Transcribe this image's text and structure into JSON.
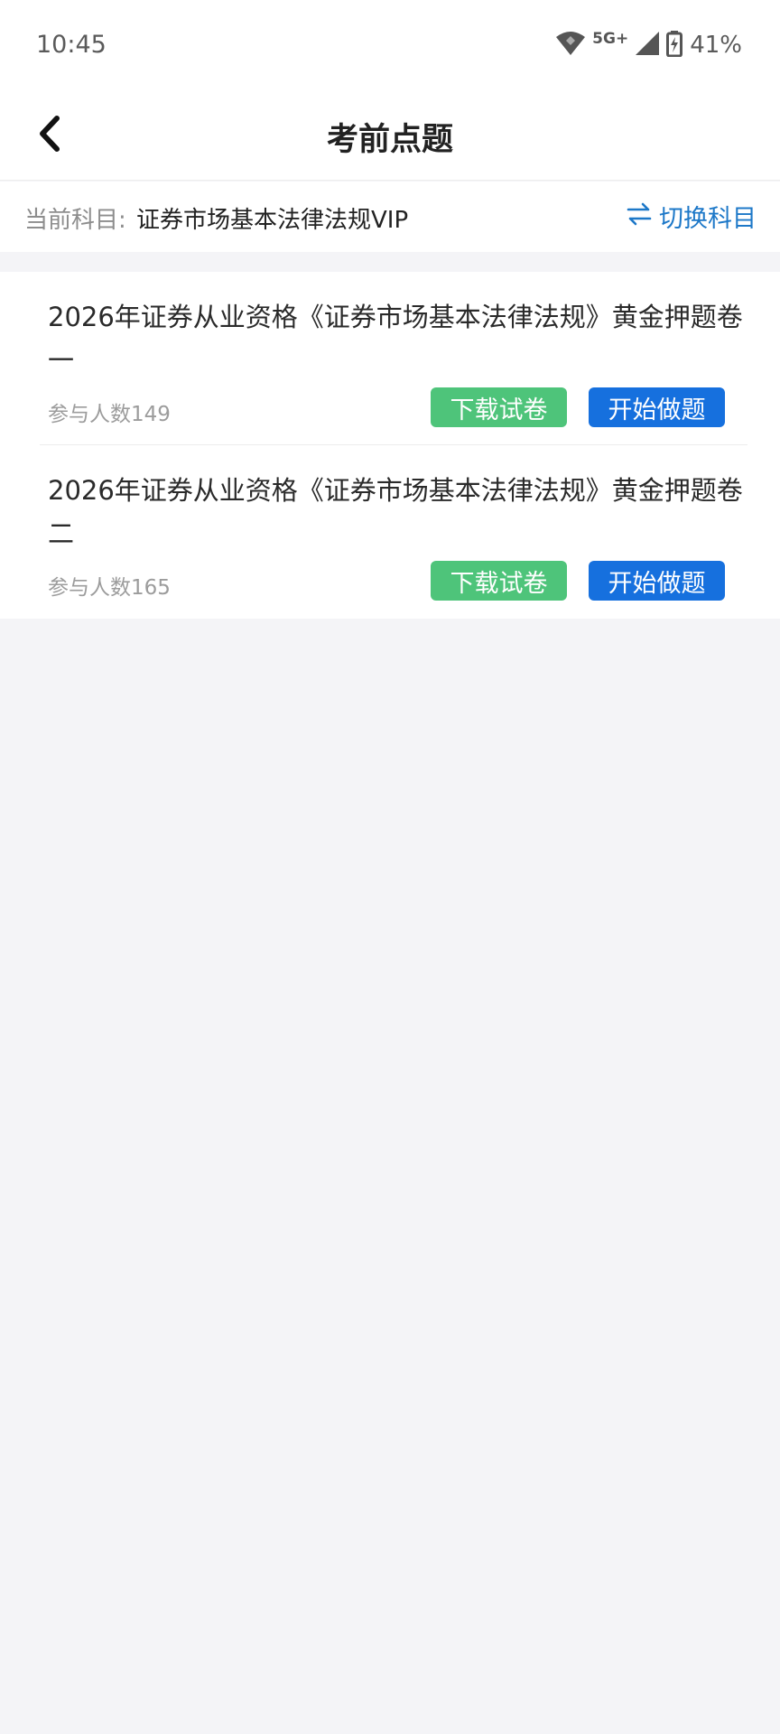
{
  "status_bar": {
    "time": "10:45",
    "network": "5G+",
    "battery": "41%"
  },
  "nav": {
    "title": "考前点题"
  },
  "subject": {
    "label": "当前科目:",
    "value": "证券市场基本法律法规VIP",
    "switch_label": "切换科目",
    "accent_color": "#1d78c8"
  },
  "papers": [
    {
      "title": "2026年证券从业资格《证券市场基本法律法规》黄金押题卷一",
      "participants": "参与人数149",
      "download_label": "下载试卷",
      "start_label": "开始做题"
    },
    {
      "title": "2026年证券从业资格《证券市场基本法律法规》黄金押题卷二",
      "participants": "参与人数165",
      "download_label": "下载试卷",
      "start_label": "开始做题"
    }
  ],
  "colors": {
    "download_button": "#4ec47a",
    "start_button": "#1670de",
    "background": "#f4f4f7"
  }
}
